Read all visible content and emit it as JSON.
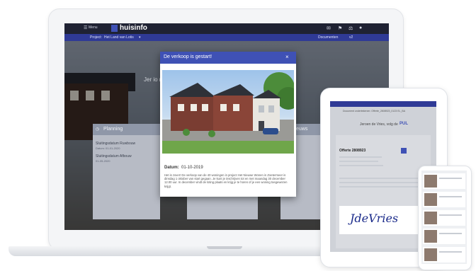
{
  "app": {
    "menu_label": "Menu",
    "logo_text": "huisinfo",
    "project_label": "Project:",
    "project_name": "Het Land van Lotis",
    "project_caret": "▾",
    "documents_label": "Documenten",
    "extra_label": "v2",
    "hero_heading": "Jer   io   r",
    "icons": [
      "chat-icon",
      "bell-icon",
      "basket-icon",
      "user-icon"
    ]
  },
  "cards": [
    {
      "title": "Planning",
      "label1": "Sluitingsdatum Ruwbouw",
      "val1": "Datum: 01-01-2020",
      "label2": "Sluitingsdatum Afbouw",
      "val2": "01-05-2020"
    },
    {
      "title": "euws"
    }
  ],
  "modal": {
    "title": "De verkoop is gestart!",
    "close": "×",
    "date_label": "Datum:",
    "date_value": "01-10-2019",
    "body": "Het is zover! De verkoop van de 40 woningen in project Het Nieuwe Wonen in Zoetermeer is dinsdag 1 oktober van start gegaan. Je kunt je inschrijven tot en met maandag 30 december 12.00 uur. In december vindt de loting plaats en krijg je te horen of je een woning toegewezen krijgt."
  },
  "tablet": {
    "header": "Document ondertekenen: Offerte_2808923_0123 EL_BA",
    "subtitle": "Jeroen de Vries, volg de",
    "brand": "PUL",
    "doc_title": "Offerte 2808923",
    "signature": "JdeVries"
  },
  "colors": {
    "primary": "#3f51b5",
    "navy": "#1f2233",
    "subbar": "#2f3a96"
  }
}
